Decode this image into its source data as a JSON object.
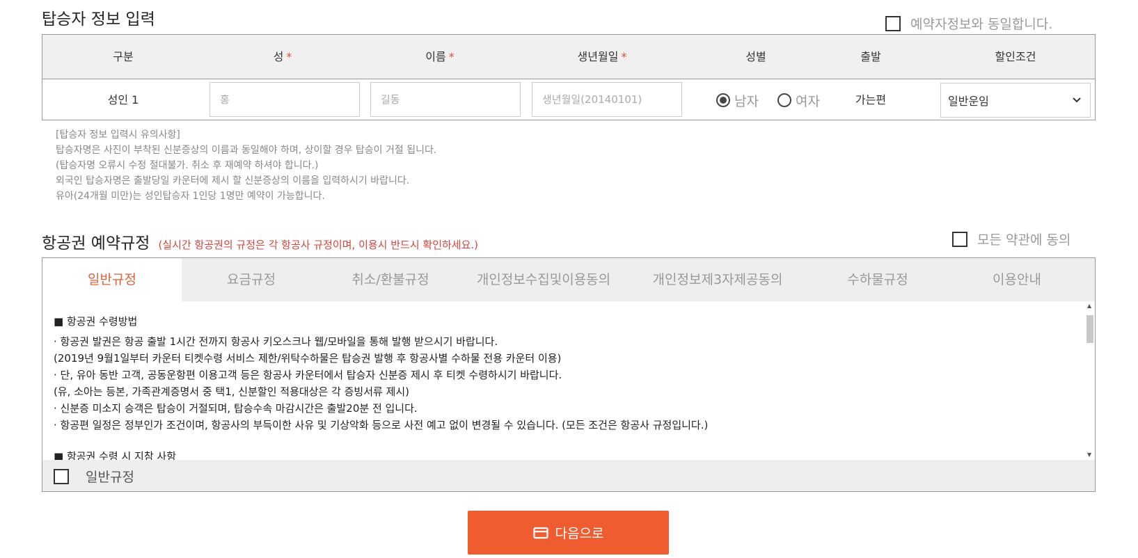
{
  "passenger": {
    "title": "탑승자 정보 입력",
    "same_as_booker": "예약자정보와 동일합니다.",
    "headers": {
      "type": "구분",
      "last_name": "성",
      "first_name": "이름",
      "birth": "생년월일",
      "gender": "성별",
      "depart": "출발",
      "discount": "할인조건",
      "required_mark": "*"
    },
    "row": {
      "type": "성인 1",
      "last_name_placeholder": "홍",
      "first_name_placeholder": "길동",
      "birth_placeholder": "생년월일(20140101)",
      "male": "남자",
      "female": "여자",
      "depart": "가는편",
      "discount_selected": "일반운임"
    },
    "notes": [
      "[탑승자 정보 입력시 유의사항]",
      "탑승자명은 사진이 부착된 신분증상의 이름과 동일해야 하며, 상이할 경우 탑승이 거절 됩니다.",
      "(탑승자명 오류시 수정 절대불가. 취소 후 재예약 하셔야 합니다.)",
      "외국인 탑승자명은 출발당일 카운터에 제시 할 신분증상의 이름을 입력하시기 바랍니다.",
      "유아(24개월 미만)는 성인탑승자 1인당 1명만 예약이 가능합니다."
    ]
  },
  "rules": {
    "title": "항공권 예약규정",
    "subtitle": "(실시간 항공권의 규정은 각 항공사 규정이며, 이용시 반드시 확인하세요.)",
    "agree_all": "모든 약관에 동의",
    "tabs": [
      "일반규정",
      "요금규정",
      "취소/환불규정",
      "개인정보수집및이용동의",
      "개인정보제3자제공동의",
      "수하물규정",
      "이용안내"
    ],
    "content": [
      "■  항공권 수령방법",
      "·  항공권 발권은 항공 출발 1시간 전까지 항공사 키오스크나 웹/모바일을 통해 발행 받으시기 바랍니다.",
      "    (2019년 9월1일부터 카운터 티켓수령 서비스 제한/위탁수하물은 탑승권 발행 후 항공사별 수하물 전용 카운터 이용)",
      "·  단, 유아 동반 고객, 공동운항편 이용고객 등은 항공사 카운터에서 탑승자 신분증 제시 후 티켓 수령하시기 바랍니다.",
      "    (유, 소아는 등본, 가족관계증명서 중 택1, 신분할인 적용대상은 각 증빙서류 제시)",
      "·  신분증 미소지 승객은 탑승이 거절되며, 탑승수속 마감시간은 출발20분 전 입니다.",
      "·  항공편 일정은 정부인가 조건이며, 항공사의 부득이한 사유 및 기상악화 등으로 사전 예고 없이 변경될 수 있습니다. (모든 조건은 항공사 규정입니다.)",
      "■  항공권 수령 시 지참 사항"
    ],
    "footer_check": "일반규정"
  },
  "next_button": "다음으로",
  "colors": {
    "accent": "#ef5c2f",
    "required": "#e04a3c",
    "subtitle": "#d9433a"
  }
}
